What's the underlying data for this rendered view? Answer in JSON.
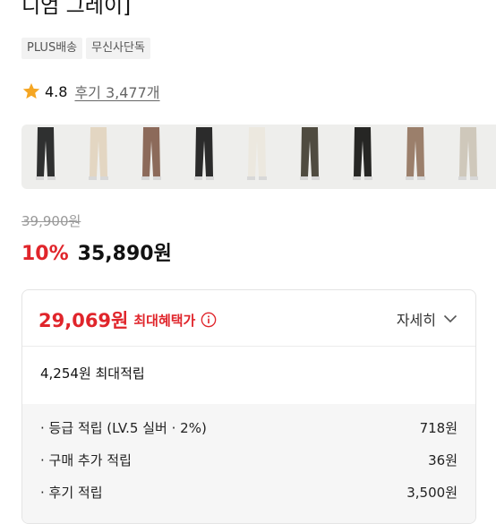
{
  "product": {
    "title_fragment": "디엄 그레이]",
    "tags": [
      "PLUS배송",
      "무신사단독"
    ]
  },
  "rating": {
    "score": "4.8",
    "reviews": "후기 3,477개"
  },
  "gallery": {
    "pant_colors": [
      "#2f3030",
      "#e3d6c2",
      "#8c6a5a",
      "#2b2b2b",
      "#ece8df",
      "#4f4b40",
      "#262624",
      "#9b7f6b",
      "#cfc8bb"
    ]
  },
  "price": {
    "original": "39,900원",
    "discount_rate": "10%",
    "sale": "35,890원"
  },
  "benefit": {
    "max_price": "29,069원",
    "max_label": "최대혜택가",
    "detail_label": "자세히",
    "points_total": "4,254원 최대적립",
    "rows": [
      {
        "label": "· 등급 적립 (LV.5 실버 · 2%)",
        "value": "718원"
      },
      {
        "label": "· 구매 추가 적립",
        "value": "36원"
      },
      {
        "label": "· 후기 적립",
        "value": "3,500원"
      }
    ]
  },
  "colors": {
    "accent_red": "#e0252b",
    "star": "#f5a623"
  }
}
